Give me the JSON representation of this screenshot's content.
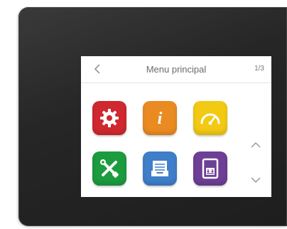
{
  "header": {
    "title": "Menu principal",
    "page_indicator": "1/3"
  },
  "icons": [
    {
      "name": "settings-gear-icon",
      "color": "#d0282f"
    },
    {
      "name": "info-icon",
      "color": "#ea8b22",
      "glyph": "i"
    },
    {
      "name": "gauge-icon",
      "color": "#f2ca13"
    },
    {
      "name": "tools-icon",
      "color": "#1c9b3f"
    },
    {
      "name": "inbox-tray-icon",
      "color": "#3f7ec9"
    },
    {
      "name": "unit-display-icon",
      "color": "#6d3f95"
    }
  ],
  "colors": {
    "device_frame": "#262626",
    "screen_background": "#ffffff",
    "header_text": "#6b6b6b"
  }
}
